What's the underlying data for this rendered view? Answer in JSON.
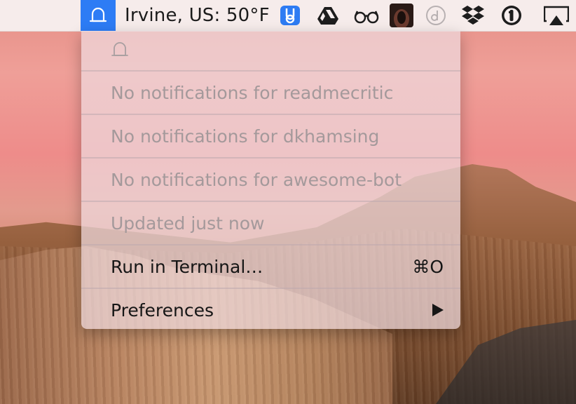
{
  "menubar": {
    "weather_label": "Irvine, US: 50°F",
    "icons": [
      "bell-icon",
      "mobile-app-icon",
      "google-drive-icon",
      "glasses-icon",
      "profile-photo-icon",
      "d-circle-icon",
      "dropbox-icon",
      "1password-icon",
      "airplay-icon"
    ],
    "active_bg_color": "#2d7cf5"
  },
  "menu": {
    "header_icon": "bell-icon",
    "items": [
      {
        "label": "No notifications for readmecritic",
        "enabled": false
      },
      {
        "label": "No notifications for dkhamsing",
        "enabled": false
      },
      {
        "label": "No notifications for awesome-bot",
        "enabled": false
      },
      {
        "label": "Updated just now",
        "enabled": false
      },
      {
        "label": "Run in Terminal…",
        "shortcut": "⌘O",
        "enabled": true
      },
      {
        "label": "Preferences",
        "submenu": true,
        "enabled": true
      }
    ]
  }
}
